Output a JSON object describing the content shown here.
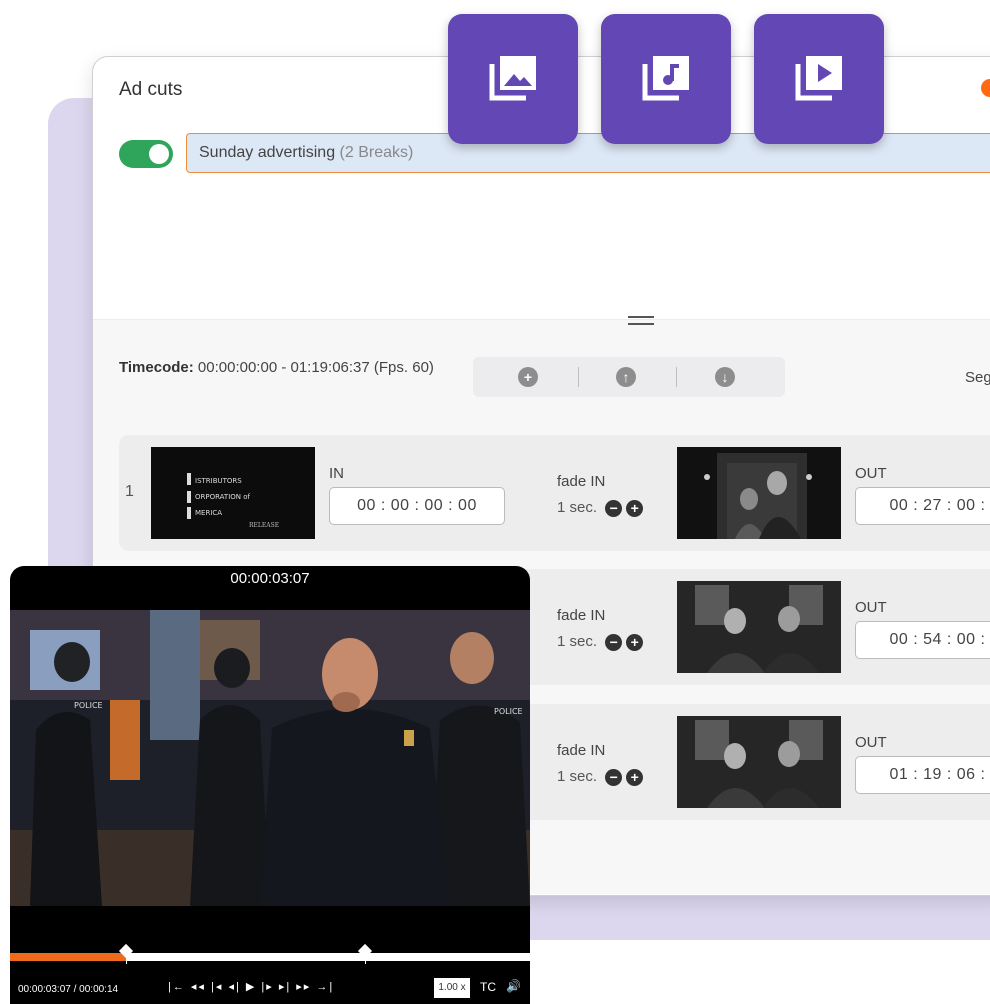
{
  "panel": {
    "title": "Ad cuts"
  },
  "playlist": {
    "name": "Sunday advertising",
    "breaks": "(2 Breaks)"
  },
  "timecode": {
    "label": "Timecode:",
    "value": "00:00:00:00 - 01:19:06:37 (Fps. 60)"
  },
  "toolbar": {
    "add": "+",
    "up": "↑",
    "down": "↓"
  },
  "seg_label": "Seg",
  "rows": [
    {
      "num": "1",
      "in_label": "IN",
      "in_value": "00 : 00 : 00 : 00",
      "fade_label": "fade IN",
      "fade_value": "1 sec.",
      "out_label": "OUT",
      "out_value": "00 : 27 : 00 :"
    },
    {
      "fade_label": "fade IN",
      "fade_value": "1 sec.",
      "out_label": "OUT",
      "out_value": "00 : 54 : 00 :"
    },
    {
      "fade_label": "fade IN",
      "fade_value": "1 sec.",
      "out_label": "OUT",
      "out_value": "01 : 19 : 06 :"
    }
  ],
  "fade_buttons": {
    "minus": "−",
    "plus": "+"
  },
  "logo_thumb": {
    "line1": "ISTRIBUTORS",
    "line2": "ORPORATION of",
    "line3": "MERICA",
    "line4": "RELEASE"
  },
  "player": {
    "current_time": "00:00:03:07",
    "time_readout": "00:00:03:07 / 00:00:14",
    "progress": 0.223,
    "markers": [
      0.223,
      0.682
    ],
    "transport": "|← ◂◂ |◂ ◂| ▶ |▸ ▸| ▸▸ →|",
    "rate": "1.00 x",
    "tc": "TC",
    "volume_icon": "speaker-icon"
  },
  "colors": {
    "accent": "#6347b5",
    "orange": "#f06a1c",
    "toggle": "#2ea55a"
  },
  "icons": [
    "photo-library-icon",
    "music-library-icon",
    "video-library-icon"
  ]
}
